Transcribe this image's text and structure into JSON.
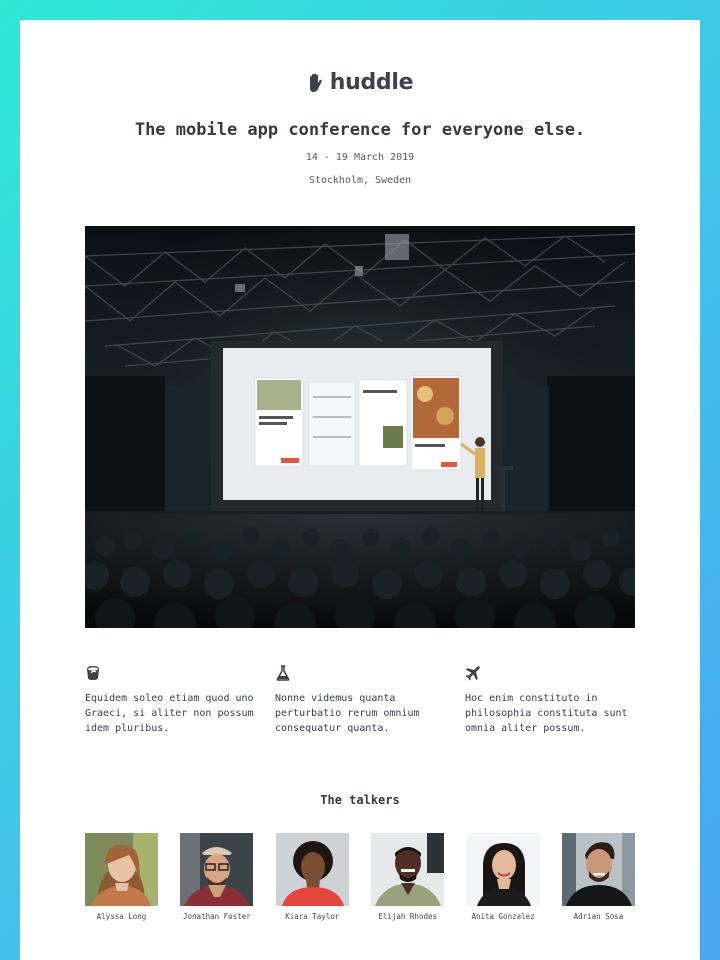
{
  "brand": {
    "name": "huddle",
    "icon": "hand-icon"
  },
  "headline": "The mobile app conference for everyone else.",
  "event": {
    "date": "14 - 19 March 2019",
    "location": "Stockholm, Sweden"
  },
  "hero": {
    "icon": "conference-stage-photo"
  },
  "features": [
    {
      "icon": "paint-bucket-icon",
      "text": "Equidem soleo etiam quod uno Graeci, si aliter non possum idem pluribus."
    },
    {
      "icon": "flask-icon",
      "text": "Nonne videmus quanta perturbatio rerum omnium consequatur quanta."
    },
    {
      "icon": "airplane-icon",
      "text": "Hoc enim constituto in philosophia constituta sunt omnia aliter possum."
    }
  ],
  "talkers": {
    "title": "The talkers",
    "people": [
      {
        "name": "Alyssa Long"
      },
      {
        "name": "Jonathan Foster"
      },
      {
        "name": "Kiara Taylor"
      },
      {
        "name": "Elijah Rhodes"
      },
      {
        "name": "Anita Gonzalez"
      },
      {
        "name": "Adrian Sosa"
      }
    ]
  },
  "colors": {
    "background_gradient_start": "#2ee9d4",
    "background_gradient_end": "#4aa6f2",
    "text": "#333b40"
  }
}
